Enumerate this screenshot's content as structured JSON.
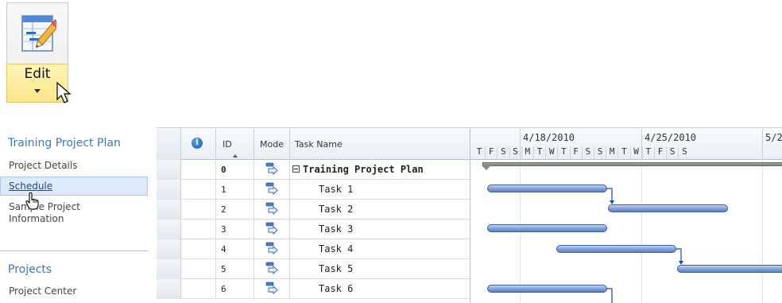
{
  "ribbon": {
    "edit_label": "Edit"
  },
  "nav": {
    "project_heading": "Training Project Plan",
    "items": [
      "Project Details",
      "Schedule",
      "Sample Project Information"
    ],
    "projects_heading": "Projects",
    "project_center": "Project Center"
  },
  "grid": {
    "headers": {
      "id": "ID",
      "mode": "Mode",
      "task_name": "Task Name"
    },
    "rows": [
      {
        "id": "0",
        "name": "Training Project Plan"
      },
      {
        "id": "1",
        "name": "Task 1"
      },
      {
        "id": "2",
        "name": "Task 2"
      },
      {
        "id": "3",
        "name": "Task 3"
      },
      {
        "id": "4",
        "name": "Task 4"
      },
      {
        "id": "5",
        "name": "Task 5"
      },
      {
        "id": "6",
        "name": "Task 6"
      }
    ]
  },
  "gantt": {
    "weeks": [
      "4/18/2010",
      "4/25/2010",
      "5/2"
    ],
    "days": [
      "T",
      "F",
      "S",
      "S",
      "M",
      "T",
      "W",
      "T",
      "F",
      "S",
      "S",
      "M",
      "T",
      "W",
      "T",
      "F",
      "S",
      "S"
    ]
  },
  "colors": {
    "accent": "#3f78b8",
    "bar": "#7f9fd6",
    "selected": "#dcebfc"
  }
}
